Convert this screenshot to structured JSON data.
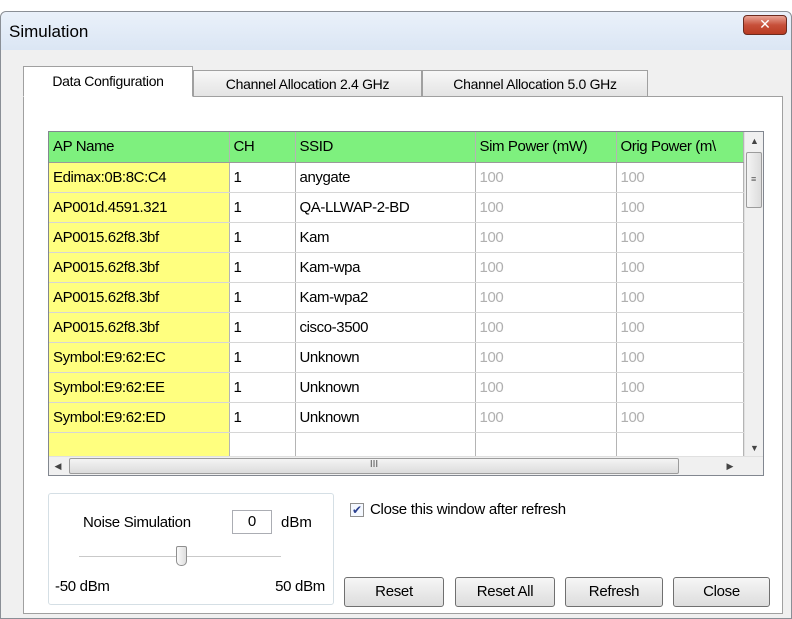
{
  "window": {
    "title": "Simulation",
    "close_glyph": "✕"
  },
  "tabs": [
    {
      "label": "Data Configuration",
      "active": true
    },
    {
      "label": "Channel Allocation 2.4 GHz",
      "active": false
    },
    {
      "label": "Channel Allocation 5.0 GHz",
      "active": false
    }
  ],
  "table": {
    "columns": [
      "AP Name",
      "CH",
      "SSID",
      "Sim Power (mW)",
      "Orig Power (m\\"
    ],
    "rows": [
      [
        "Edimax:0B:8C:C4",
        "1",
        "anygate",
        "100",
        "100"
      ],
      [
        "AP001d.4591.321",
        "1",
        "QA-LLWAP-2-BD",
        "100",
        "100"
      ],
      [
        "AP0015.62f8.3bf",
        "1",
        "Kam",
        "100",
        "100"
      ],
      [
        "AP0015.62f8.3bf",
        "1",
        "Kam-wpa",
        "100",
        "100"
      ],
      [
        "AP0015.62f8.3bf",
        "1",
        "Kam-wpa2",
        "100",
        "100"
      ],
      [
        "AP0015.62f8.3bf",
        "1",
        "cisco-3500",
        "100",
        "100"
      ],
      [
        "Symbol:E9:62:EC",
        "1",
        "Unknown",
        "100",
        "100"
      ],
      [
        "Symbol:E9:62:EE",
        "1",
        "Unknown",
        "100",
        "100"
      ],
      [
        "Symbol:E9:62:ED",
        "1",
        "Unknown",
        "100",
        "100"
      ],
      [
        "",
        "",
        "",
        "",
        ""
      ]
    ],
    "colors": {
      "header": "#7ef07e",
      "ap_cell": "#ffff7f",
      "dim_text": "#b0b0b0"
    }
  },
  "scroll": {
    "up": "▲",
    "down": "▼",
    "left": "◀",
    "right": "▶",
    "hgrip": "III",
    "vgrip": "≡"
  },
  "noise": {
    "label": "Noise Simulation",
    "value": "0",
    "unit": "dBm",
    "min_label": "-50 dBm",
    "max_label": "50 dBm",
    "slider_value": 0,
    "slider_min": -50,
    "slider_max": 50
  },
  "close_after_refresh": {
    "label": "Close this window after refresh",
    "checked": true,
    "check_glyph": "✔"
  },
  "buttons": {
    "reset": "Reset",
    "reset_all": "Reset All",
    "refresh": "Refresh",
    "close": "Close"
  }
}
